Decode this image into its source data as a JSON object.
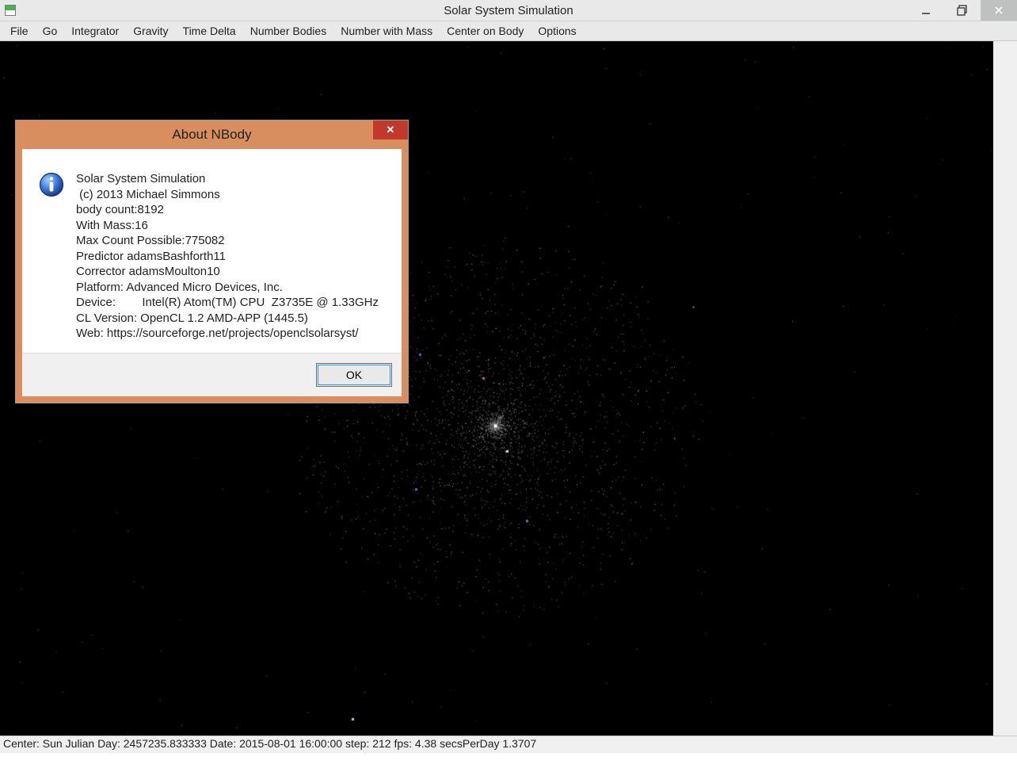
{
  "window": {
    "title": "Solar System Simulation"
  },
  "menu": {
    "items": [
      "File",
      "Go",
      "Integrator",
      "Gravity",
      "Time Delta",
      "Number Bodies",
      "Number with Mass",
      "Center on Body",
      "Options"
    ]
  },
  "status": {
    "text": "Center: Sun Julian Day: 2457235.833333 Date: 2015-08-01 16:00:00 step: 212 fps: 4.38 secsPerDay 1.3707"
  },
  "dialog": {
    "title": "About NBody",
    "close_glyph": "✕",
    "ok_label": "OK",
    "lines": {
      "l0": "Solar System Simulation",
      "l1": " (c) 2013 Michael Simmons",
      "l2": "body count:8192",
      "l3": "With Mass:16",
      "l4": "Max Count Possible:775082",
      "l5": "Predictor adamsBashforth11",
      "l6": "Corrector adamsMoulton10",
      "l7": "Platform: Advanced Micro Devices, Inc.",
      "l8": "Device:        Intel(R) Atom(TM) CPU  Z3735E @ 1.33GHz",
      "l9": "CL Version: OpenCL 1.2 AMD-APP (1445.5)",
      "l10": "Web: https://sourceforge.net/projects/openclsolarsyst/"
    }
  }
}
